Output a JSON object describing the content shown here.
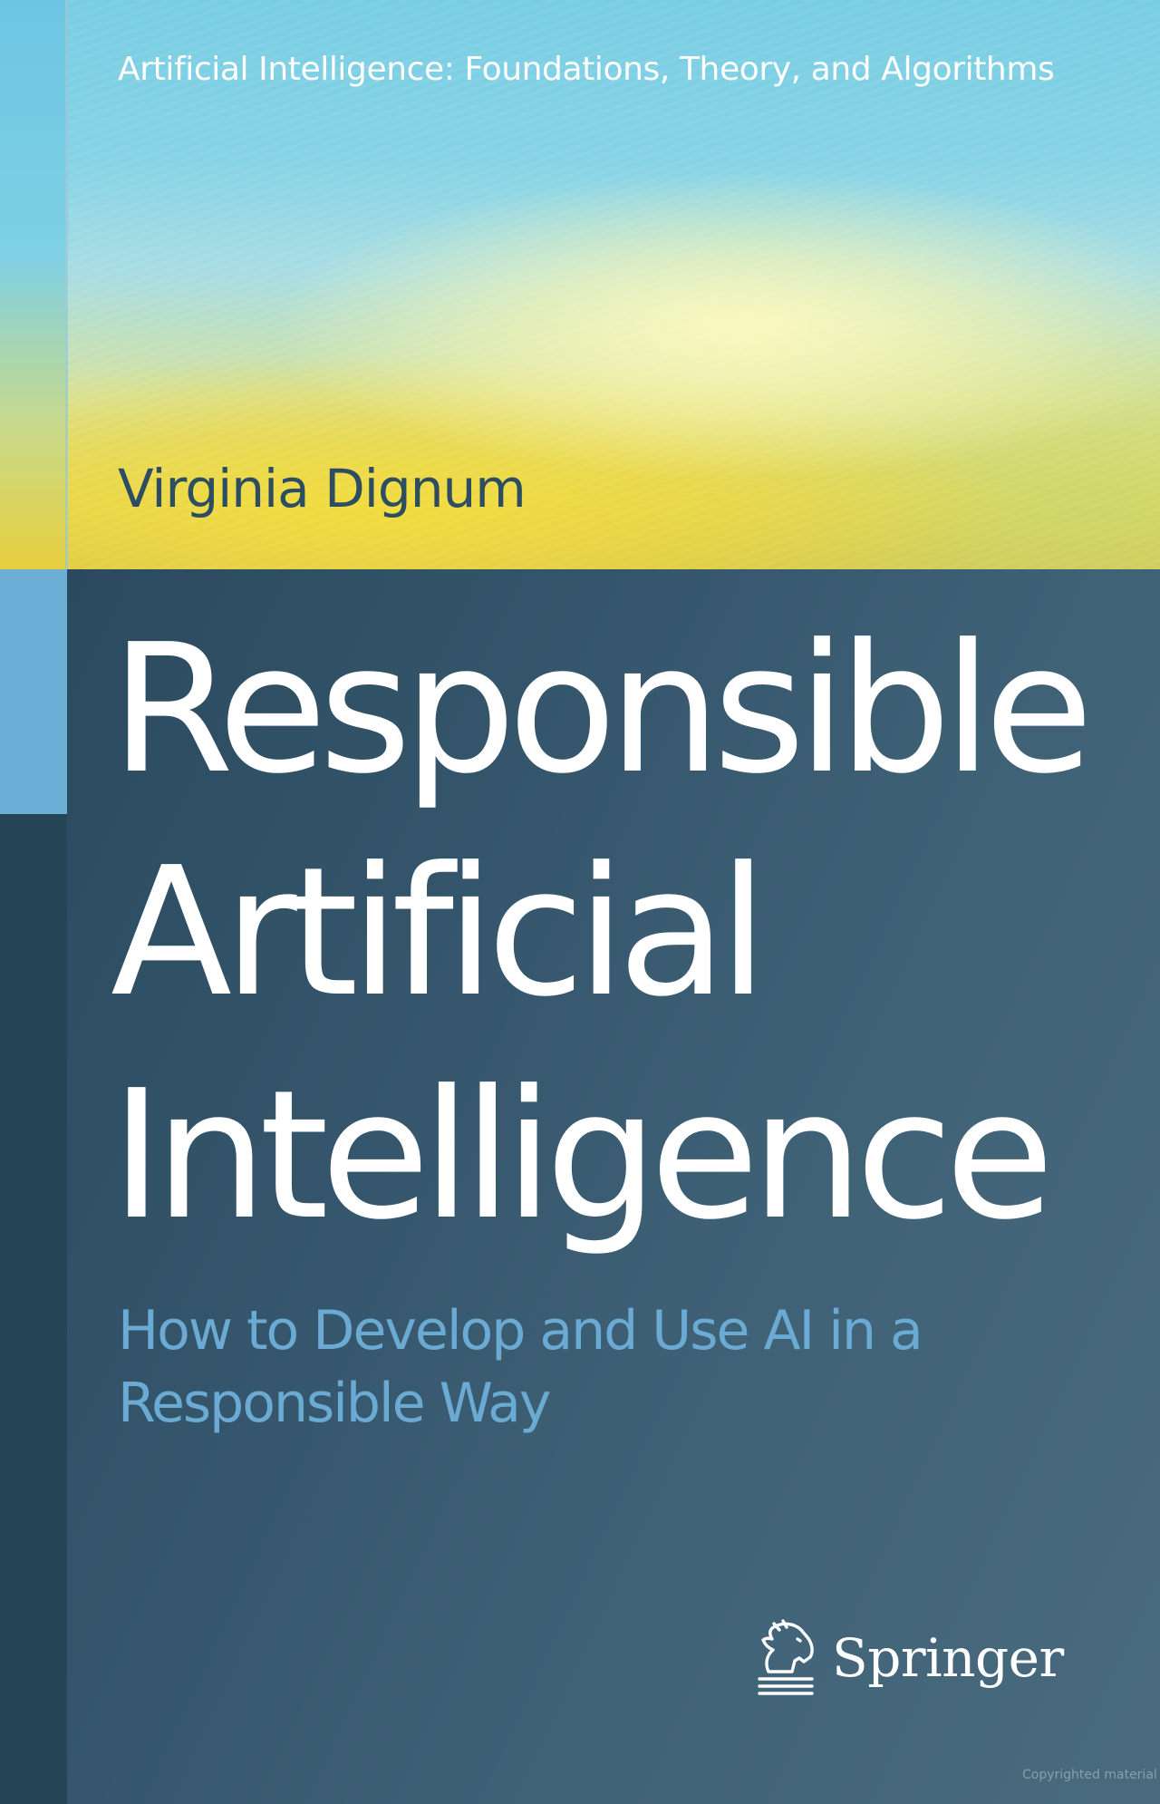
{
  "cover": {
    "series": "Artificial Intelligence: Foundations, Theory, and Algorithms",
    "author": "Virginia Dignum",
    "title_lines": [
      "Responsible",
      "Artificial",
      "Intelligence"
    ],
    "subtitle_lines": [
      "How to Develop and Use AI in a",
      "Responsible Way"
    ],
    "publisher": "Springer",
    "publisher_logo_icon": "springer-horse-logo-icon",
    "watermark": "Copyrighted material"
  },
  "colors": {
    "body_background": "#35566c",
    "title_text": "#ffffff",
    "subtitle_text": "#6aaad3",
    "author_text": "#2d4d63",
    "left_accent": "#6bafd6",
    "top_gradient_blue": "#79cde3",
    "top_gradient_yellow": "#e2d75a"
  }
}
